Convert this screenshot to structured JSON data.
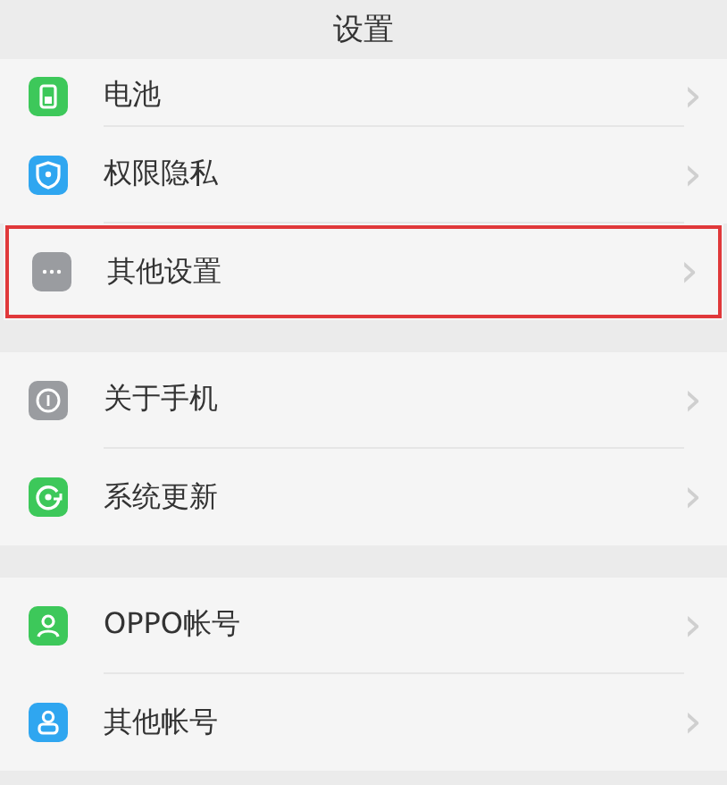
{
  "header": {
    "title": "设置"
  },
  "groups": [
    {
      "items": [
        {
          "label": "电池",
          "kind": "battery",
          "color": "#3dc85a",
          "selected": false,
          "chevron": "›"
        },
        {
          "label": "权限隐私",
          "kind": "shield",
          "color": "#2fa6f0",
          "selected": false,
          "chevron": "›"
        },
        {
          "label": "其他设置",
          "kind": "more",
          "color": "#9a9ca0",
          "selected": true,
          "chevron": "›"
        }
      ]
    },
    {
      "items": [
        {
          "label": "关于手机",
          "kind": "info",
          "color": "#9a9ca0",
          "selected": false,
          "chevron": "›"
        },
        {
          "label": "系统更新",
          "kind": "update",
          "color": "#3dc85a",
          "selected": false,
          "chevron": "›"
        }
      ]
    },
    {
      "items": [
        {
          "label": "OPPO帐号",
          "kind": "person",
          "color": "#3dc85a",
          "selected": false,
          "chevron": "›"
        },
        {
          "label": "其他帐号",
          "kind": "account",
          "color": "#2fa6f0",
          "selected": false,
          "chevron": "›"
        }
      ]
    }
  ]
}
